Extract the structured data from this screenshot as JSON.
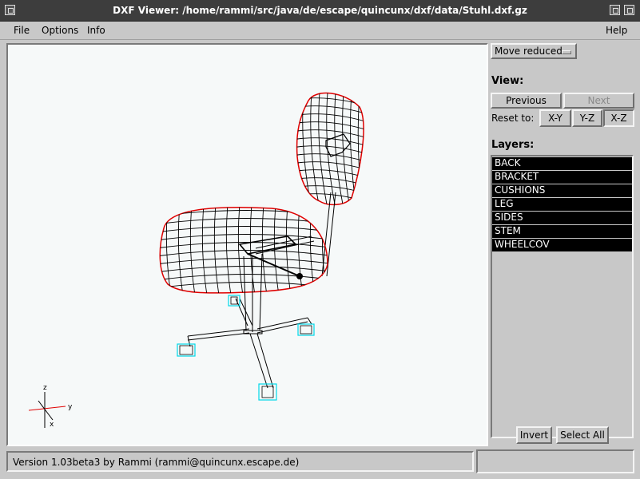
{
  "window": {
    "title": "DXF Viewer: /home/rammi/src/java/de/escape/quincunx/dxf/data/Stuhl.dxf.gz"
  },
  "menu": {
    "file": "File",
    "options": "Options",
    "info": "Info",
    "help": "Help"
  },
  "controls": {
    "move_mode": "Move reduced",
    "view_label": "View:",
    "previous": "Previous",
    "next": "Next",
    "reset_label": "Reset to:",
    "xy": "X-Y",
    "yz": "Y-Z",
    "xz": "X-Z",
    "layers_label": "Layers:",
    "layers": [
      "BACK",
      "BRACKET",
      "CUSHIONS",
      "LEG",
      "SIDES",
      "STEM",
      "WHEELCOV"
    ],
    "invert": "Invert",
    "select_all": "Select All"
  },
  "axes": {
    "z": "z",
    "y": "y",
    "x": "x"
  },
  "status": {
    "text": "Version 1.03beta3 by Rammi  (rammi@quincunx.escape.de)"
  },
  "colors": {
    "wire_main": "#000000",
    "wire_outline": "#e00000",
    "wheel": "#00d8e8"
  }
}
